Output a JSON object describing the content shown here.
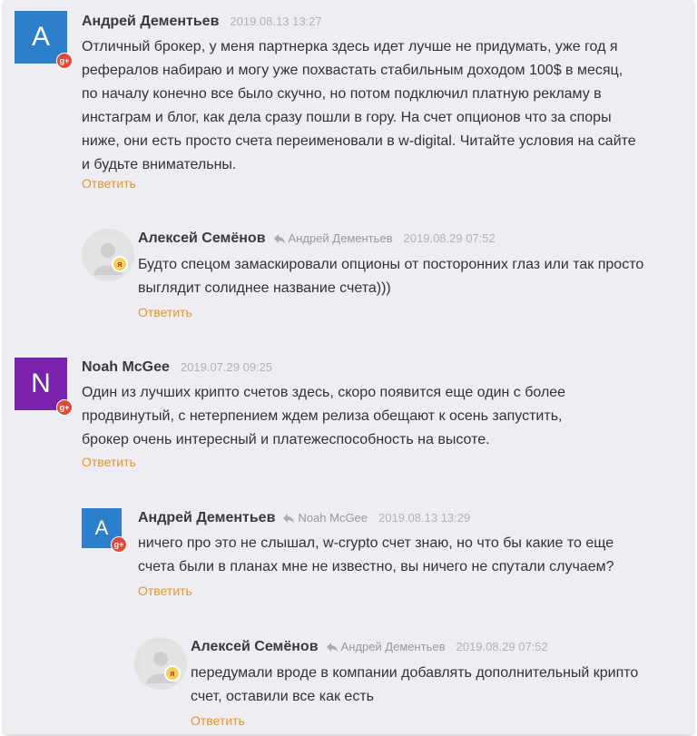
{
  "comments": [
    {
      "author": "Андрей Дементьев",
      "date": "2019.08.13 13:27",
      "avatar_letter": "A",
      "lines": [
        "Отличный брокер, у меня партнерка здесь идет лучше не придумать, уже год я",
        "рефералов набираю и могу уже похвастать стабильным доходом 100$ в месяц,",
        "по началу конечно все было скучно, но потом подключил платную рекламу в",
        "инстаграм и блог, как дела сразу пошли в гору. На счет опционов что за споры",
        "ниже, они есть просто счета переименовали в w-digital. Читайте условия на сайте",
        "и будьте внимательны."
      ],
      "reply_label": "Ответить"
    },
    {
      "author": "Алексей Семёнов",
      "reply_to": "Андрей Дементьев",
      "date": "2019.08.29 07:52",
      "lines": [
        "Будто спецом замаскировали опционы от посторонних глаз или так просто",
        "выглядит солиднее название счета)))"
      ],
      "reply_label": "Ответить"
    },
    {
      "author": "Noah McGee",
      "date": "2019.07.29 09:25",
      "avatar_letter": "N",
      "lines": [
        "Один из лучших крипто счетов здесь, скоро появится еще один с более",
        "продвинутый, с нетерпением ждем релиза обещают к осень запустить,",
        "брокер очень  интересный и платежеспособность на высоте."
      ],
      "reply_label": "Ответить"
    },
    {
      "author": "Андрей Дементьев",
      "reply_to": "Noah McGee",
      "date": "2019.08.13 13:29",
      "avatar_letter": "A",
      "lines": [
        "ничего про это не слышал, w-crypto счет знаю, но что бы какие то еще",
        "счета были в планах мне не известно, вы ничего не спутали случаем?"
      ],
      "reply_label": "Ответить"
    },
    {
      "author": "Алексей Семёнов",
      "reply_to": "Андрей Дементьев",
      "date": "2019.08.29 07:52",
      "lines": [
        "передумали вроде в компании добавлять дополнительный крипто",
        "счет, оставили все как есть"
      ],
      "reply_label": "Ответить"
    }
  ],
  "badges": {
    "gplus": "g+",
    "yandex": "я"
  },
  "icons": [
    "reply-arrow-icon",
    "google-plus-icon",
    "yandex-icon",
    "user-silhouette-icon"
  ],
  "colors": {
    "reply_link": "#e6962a",
    "avatar_blue": "#2c7fcb",
    "avatar_purple": "#7a22ae",
    "gplus_badge": "#dd4b39",
    "background": "#eeedf4"
  }
}
